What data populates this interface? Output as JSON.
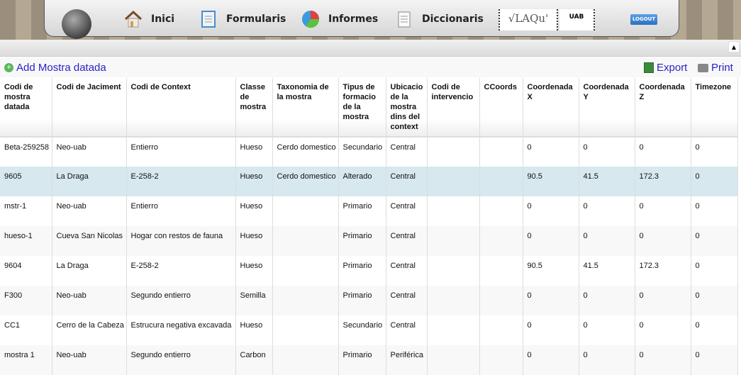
{
  "nav": {
    "items": [
      {
        "label": "Inici",
        "icon": "home-icon"
      },
      {
        "label": "Formularis",
        "icon": "form-icon"
      },
      {
        "label": "Informes",
        "icon": "pie-chart-icon"
      },
      {
        "label": "Diccionaris",
        "icon": "notepad-icon"
      }
    ],
    "logo1": "LAQu",
    "logo2": "UAB",
    "logout": "LOGOUT"
  },
  "toolbar": {
    "add": "Add Mostra datada",
    "export": "Export",
    "print": "Print"
  },
  "table": {
    "headers": [
      "Codi de mostra datada",
      "Codi de Jaciment",
      "Codi de Context",
      "Classe de mostra",
      "Taxonomia de la mostra",
      "Tipus de formacio de la mostra",
      "Ubicacio de la mostra dins del context",
      "Codi de intervencio",
      "CCoords",
      "Coordenada X",
      "Coordenada Y",
      "Coordenada Z",
      "Timezone"
    ],
    "rows": [
      [
        "Beta-259258",
        "Neo-uab",
        "Entierro",
        "Hueso",
        "Cerdo domestico",
        "Secundario",
        "Central",
        "",
        "",
        "0",
        "0",
        "0",
        "0"
      ],
      [
        "9605",
        "La Draga",
        "E-258-2",
        "Hueso",
        "Cerdo domestico",
        "Alterado",
        "Central",
        "",
        "",
        "90.5",
        "41.5",
        "172.3",
        "0"
      ],
      [
        "mstr-1",
        "Neo-uab",
        "Entierro",
        "Hueso",
        "",
        "Primario",
        "Central",
        "",
        "",
        "0",
        "0",
        "0",
        "0"
      ],
      [
        "hueso-1",
        "Cueva San Nicolas",
        "Hogar con restos de fauna",
        "Hueso",
        "",
        "Primario",
        "Central",
        "",
        "",
        "0",
        "0",
        "0",
        "0"
      ],
      [
        "9604",
        "La Draga",
        "E-258-2",
        "Hueso",
        "",
        "Primario",
        "Central",
        "",
        "",
        "90.5",
        "41.5",
        "172.3",
        "0"
      ],
      [
        "F300",
        "Neo-uab",
        "Segundo entierro",
        "Semilla",
        "",
        "Primario",
        "Central",
        "",
        "",
        "0",
        "0",
        "0",
        "0"
      ],
      [
        "CC1",
        "Cerro de la Cabeza",
        "Estrucura negativa excavada",
        "Hueso",
        "",
        "Secundario",
        "Central",
        "",
        "",
        "0",
        "0",
        "0",
        "0"
      ],
      [
        "mostra 1",
        "Neo-uab",
        "Segundo entierro",
        "Carbon",
        "",
        "Primario",
        "Periférica",
        "",
        "",
        "0",
        "0",
        "0",
        "0"
      ]
    ]
  }
}
